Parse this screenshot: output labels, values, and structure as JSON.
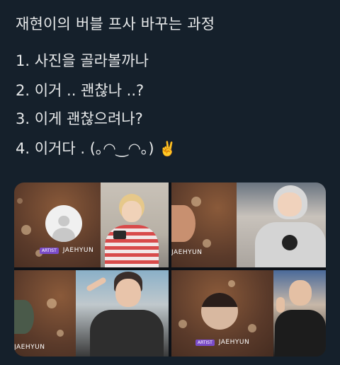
{
  "post": {
    "title": "재현이의 버블 프사 바꾸는 과정",
    "lines": [
      "1. 사진을 골라볼까나",
      "2. 이거 .. 괜찮나 ..?",
      "3. 이게 괜찮으려나?",
      "4. 이거다 .  (｡◠‿◠｡)"
    ],
    "victory_emoji": "✌️"
  },
  "media": {
    "tiles": [
      {
        "badge": "ARTIST",
        "name": "JAEHYUN"
      },
      {
        "name": "JAEHYUN"
      },
      {
        "name": "JAEHYUN"
      },
      {
        "badge": "ARTIST",
        "name": "JAEHYUN"
      }
    ]
  }
}
